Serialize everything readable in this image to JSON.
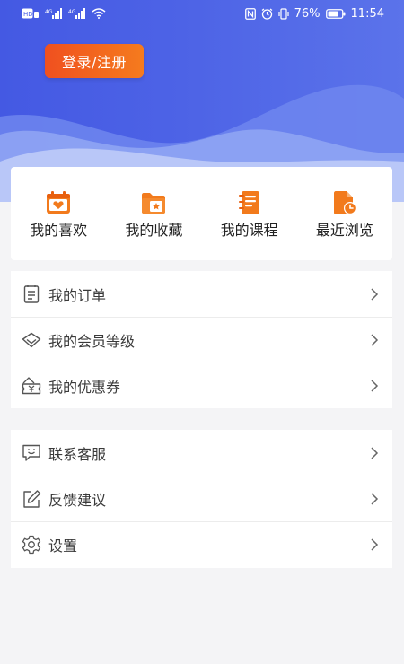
{
  "status_bar": {
    "battery": "76%",
    "time": "11:54",
    "left_icons": [
      "hd-icon",
      "signal-4g-icon",
      "signal-4g-icon",
      "wifi-icon"
    ],
    "right_icons": [
      "nfc-icon",
      "alarm-icon",
      "vibrate-icon",
      "battery-icon"
    ]
  },
  "header": {
    "login_label": "登录/注册"
  },
  "quick_actions": [
    {
      "label": "我的喜欢",
      "icon": "heart-calendar-icon"
    },
    {
      "label": "我的收藏",
      "icon": "star-folder-icon"
    },
    {
      "label": "我的课程",
      "icon": "notebook-icon"
    },
    {
      "label": "最近浏览",
      "icon": "recent-file-icon"
    }
  ],
  "menu_group_1": [
    {
      "label": "我的订单",
      "icon": "order-list-icon"
    },
    {
      "label": "我的会员等级",
      "icon": "diamond-icon"
    },
    {
      "label": "我的优惠券",
      "icon": "coupon-icon"
    }
  ],
  "menu_group_2": [
    {
      "label": "联系客服",
      "icon": "chat-smile-icon"
    },
    {
      "label": "反馈建议",
      "icon": "edit-icon"
    },
    {
      "label": "设置",
      "icon": "gear-icon"
    }
  ],
  "colors": {
    "header_blue": "#4d63e6",
    "login_orange_start": "#f0501f",
    "login_orange_end": "#f57b1e",
    "icon_orange": "#f27a1c",
    "background": "#f4f4f6"
  }
}
